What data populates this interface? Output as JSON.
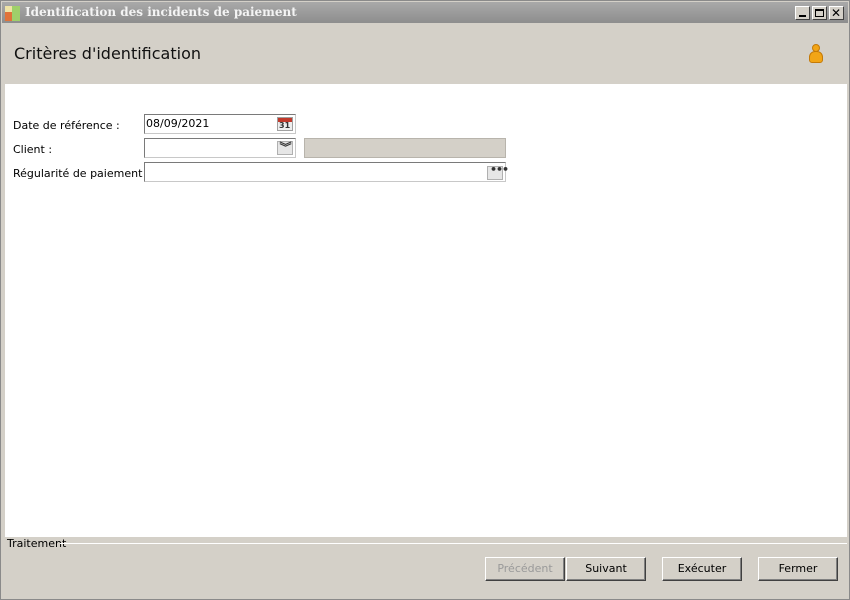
{
  "window": {
    "title": "Identification des incidents de paiement"
  },
  "header": {
    "title": "Critères d'identification"
  },
  "form": {
    "reference_date": {
      "label": "Date de référence :",
      "value": "08/09/2021"
    },
    "client": {
      "label": "Client :",
      "value": "",
      "name_value": ""
    },
    "payment_regularity": {
      "label": "Régularité de paiement :",
      "value": ""
    }
  },
  "footer": {
    "group_label": "Traitement",
    "buttons": {
      "previous": "Précédent",
      "next": "Suivant",
      "execute": "Exécuter",
      "close": "Fermer"
    }
  },
  "icons": {
    "app": "app-icon",
    "user": "user-icon",
    "calendar": "calendar-icon",
    "calendar_day": "31",
    "combo": "double-chevron-down-icon",
    "ellipsis": "ellipsis-icon",
    "ellipsis_text": "•••"
  },
  "colors": {
    "titlebar": "#999999",
    "panel": "#d4d0c8",
    "user_icon": "#f2a516",
    "calendar_accent": "#c0392b"
  }
}
